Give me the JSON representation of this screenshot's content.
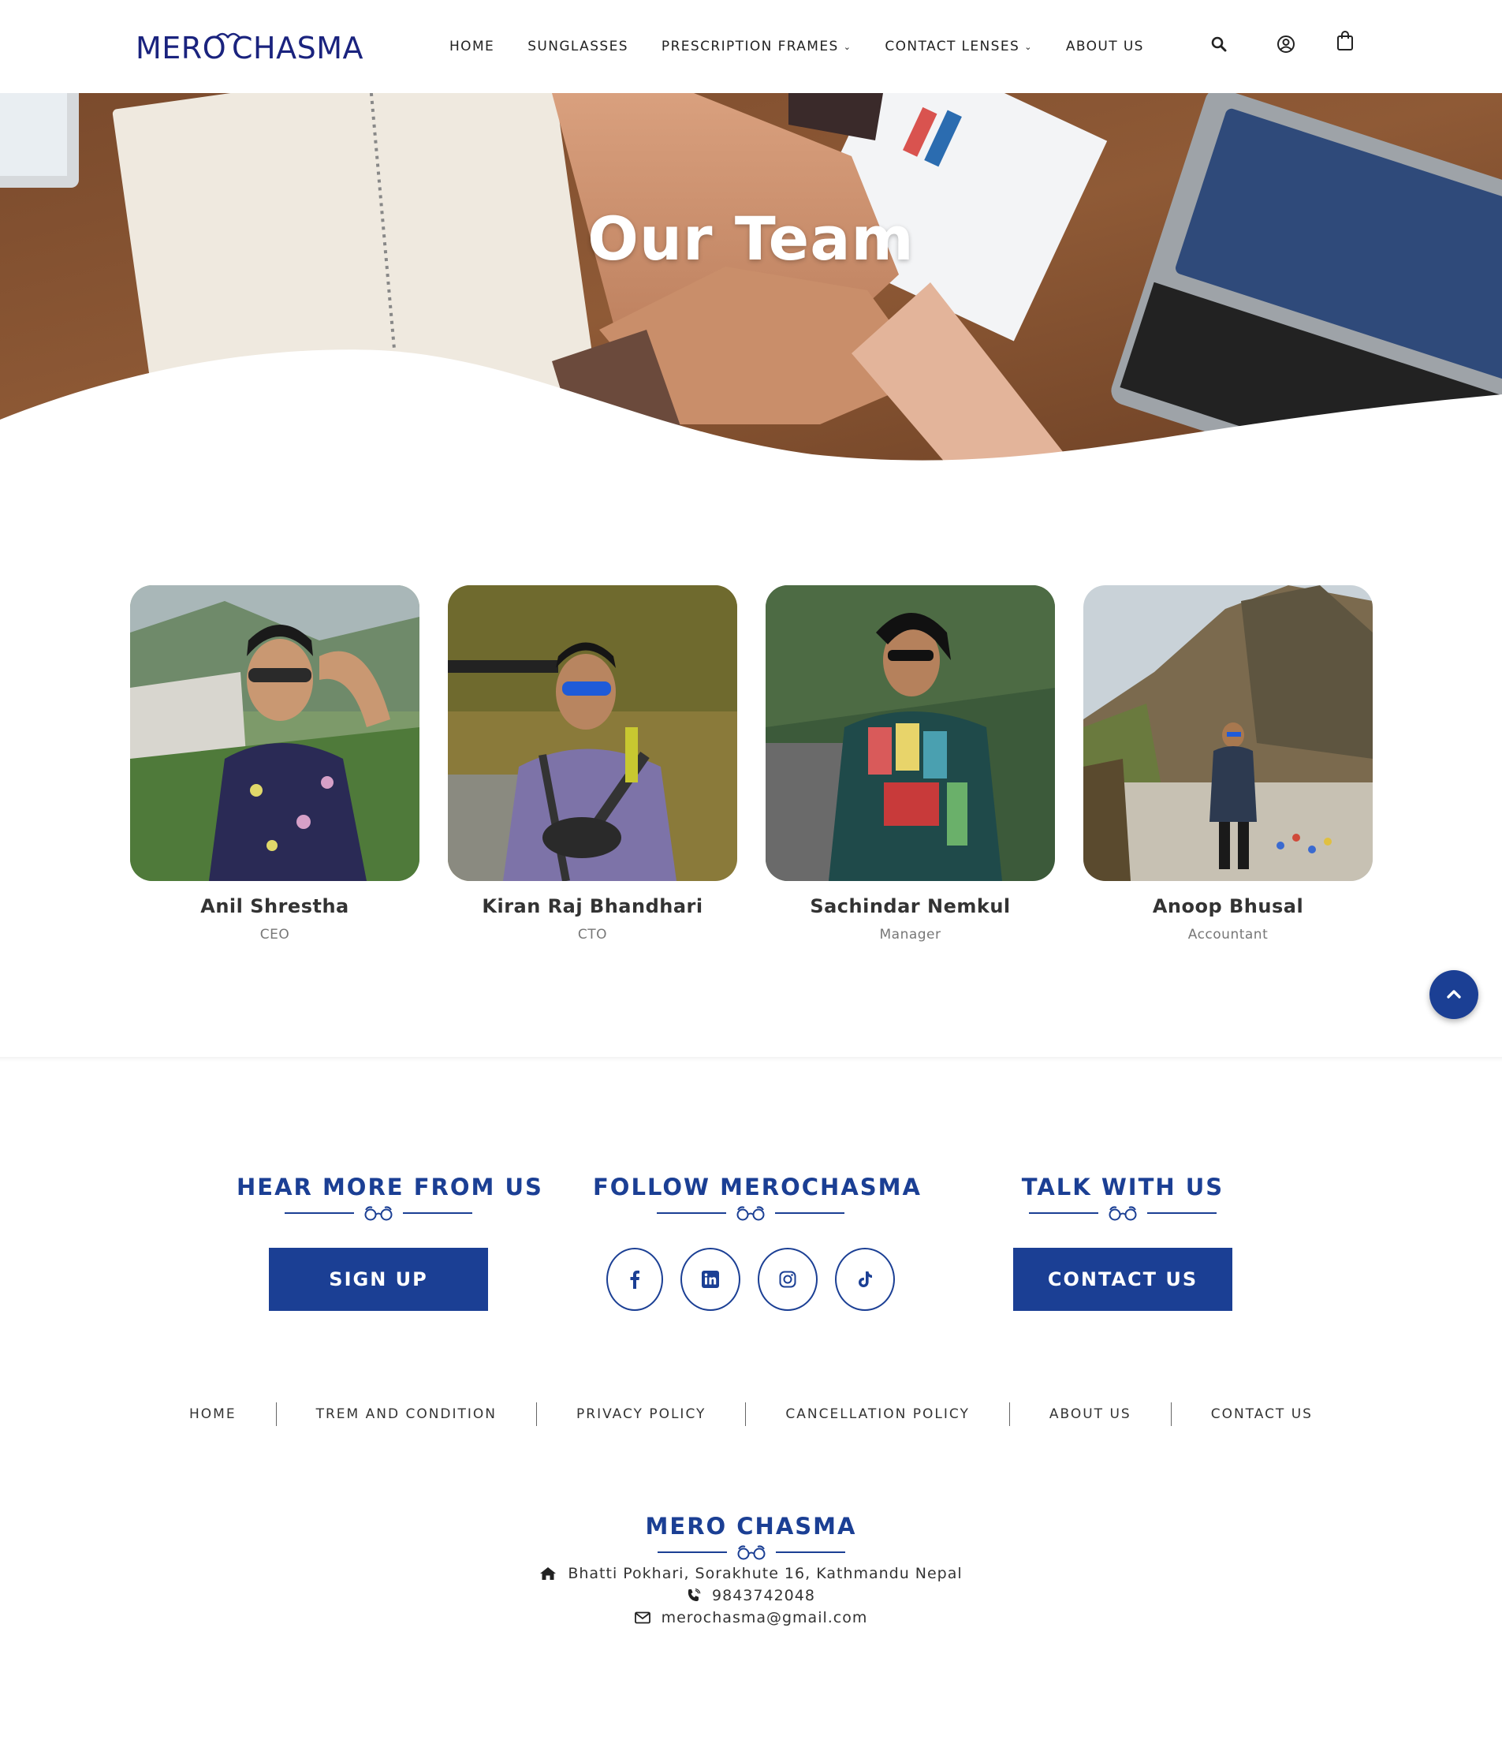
{
  "header": {
    "logo_text": "MERŌCHASMA",
    "nav": [
      {
        "label": "HOME",
        "has_caret": false
      },
      {
        "label": "SUNGLASSES",
        "has_caret": false
      },
      {
        "label": "PRESCRIPTION FRAMES",
        "has_caret": true
      },
      {
        "label": "CONTACT LENSES",
        "has_caret": true
      },
      {
        "label": "ABOUT US",
        "has_caret": false
      }
    ],
    "icons": [
      "search-icon",
      "user-icon",
      "shopping-bag-icon"
    ]
  },
  "hero": {
    "title": "Our Team"
  },
  "team": [
    {
      "name": "Anil Shrestha",
      "role": "CEO"
    },
    {
      "name": "Kiran Raj Bhandhari",
      "role": "CTO"
    },
    {
      "name": "Sachindar Nemkul",
      "role": "Manager"
    },
    {
      "name": "Anoop Bhusal",
      "role": "Accountant"
    }
  ],
  "footer": {
    "hear_more": {
      "title": "HEAR MORE FROM US",
      "button": "SIGN UP"
    },
    "follow": {
      "title": "FOLLOW MEROCHASMA",
      "socials": [
        "facebook-icon",
        "linkedin-icon",
        "instagram-icon",
        "tiktok-icon"
      ]
    },
    "talk": {
      "title": "TALK WITH US",
      "button": "CONTACT US"
    },
    "links": [
      "HOME",
      "TREM AND CONDITION",
      "PRIVACY POLICY",
      "CANCELLATION POLICY",
      "ABOUT US",
      "CONTACT US"
    ],
    "brand": {
      "title": "MERO CHASMA",
      "address": "Bhatti Pokhari, Sorakhute 16, Kathmandu Nepal",
      "phone": "9843742048",
      "email": "merochasma@gmail.com"
    }
  },
  "colors": {
    "brand_blue": "#1b3f94",
    "logo_navy": "#1a237e"
  }
}
